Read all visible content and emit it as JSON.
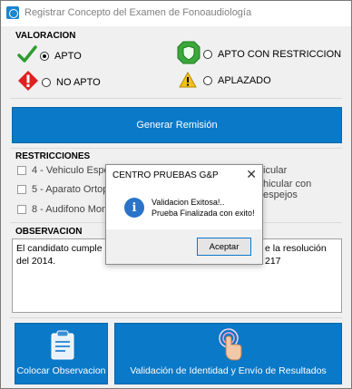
{
  "window": {
    "title": "Registrar Concepto del Examen de Fonoaudiología"
  },
  "valoracion": {
    "label": "VALORACION",
    "options": [
      {
        "label": "APTO",
        "checked": true,
        "icon": "check-icon"
      },
      {
        "label": "APTO CON RESTRICCION",
        "checked": false,
        "icon": "shield-icon"
      },
      {
        "label": "NO APTO",
        "checked": false,
        "icon": "stop-icon"
      },
      {
        "label": "APLAZADO",
        "checked": false,
        "icon": "warning-icon"
      }
    ]
  },
  "generar_button": {
    "label": "Generar Remisión"
  },
  "restricciones": {
    "label": "RESTRICCIONES",
    "items": [
      {
        "label": "4 - Vehiculo Especia"
      },
      {
        "label": "5 - Aparato Ortope"
      },
      {
        "label": "8 - Audifono Mono"
      }
    ],
    "right_fragments": [
      "icular",
      "hicular con",
      "espejos"
    ]
  },
  "observacion": {
    "label": "OBSERVACION",
    "line1_left": "El candidato cumple co",
    "line1_right": "e la resolución 217",
    "line2": "del 2014."
  },
  "bottom_buttons": {
    "colocar": "Colocar Observacion",
    "validacion": "Validación de Identidad y Envío de Resultados"
  },
  "dialog": {
    "title": "CENTRO PRUEBAS G&P",
    "close": "✕",
    "line1": "Validacion Exitosa!..",
    "line2": "Prueba Finalizada con exito!",
    "accept": "Aceptar"
  },
  "colors": {
    "accent": "#0a79c8",
    "info": "#2a73c9"
  }
}
